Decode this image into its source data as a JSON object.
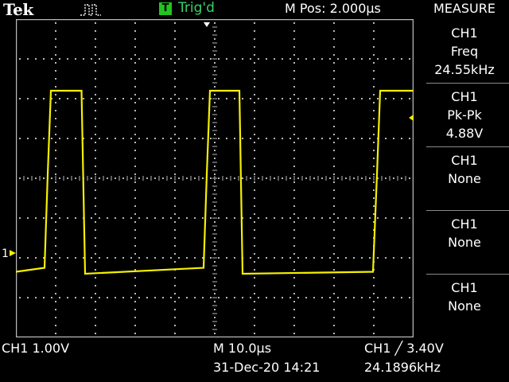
{
  "header": {
    "brand": "Tek",
    "acquisition_icon": "pulse-run-icon",
    "trigger_badge": "T",
    "trigger_status": "Trig'd",
    "horizontal_position": "M Pos: 2.000µs",
    "menu_title": "MEASURE"
  },
  "measurements": [
    {
      "source": "CH1",
      "type": "Freq",
      "value": "24.55kHz"
    },
    {
      "source": "CH1",
      "type": "Pk-Pk",
      "value": "4.88V"
    },
    {
      "source": "CH1",
      "type": "None",
      "value": ""
    },
    {
      "source": "CH1",
      "type": "None",
      "value": ""
    },
    {
      "source": "CH1",
      "type": "None",
      "value": ""
    }
  ],
  "footer": {
    "channel_scale": "CH1  1.00V",
    "timebase": "M 10.0µs",
    "date_time": "31-Dec-20 14:21",
    "trigger_setting": "CH1 ╱ 3.40V",
    "trigger_frequency": "24.1896kHz"
  },
  "markers": {
    "channel_ground": "1"
  },
  "colors": {
    "trace": "#f5f000",
    "grid": "#b8b8b8",
    "trigger_green": "#22c322",
    "background": "#000000"
  },
  "chart_data": {
    "type": "line",
    "title": "",
    "xlabel": "",
    "ylabel": "",
    "x_divisions": 10,
    "y_divisions": 8,
    "x_unit_per_div": "10.0µs",
    "y_unit_per_div": "1.00V",
    "series": [
      {
        "x_us": [
          0,
          7.2,
          8.0,
          8.8,
          16.5,
          17.4,
          47.2,
          48.0,
          48.8,
          56.2,
          57.0,
          89.8,
          90.8,
          91.6,
          100
        ],
        "y_v": [
          0.05,
          0.15,
          2.5,
          4.6,
          4.6,
          0.0,
          0.15,
          2.5,
          4.6,
          4.6,
          0.0,
          0.05,
          2.5,
          4.6,
          4.6
        ]
      }
    ]
  }
}
